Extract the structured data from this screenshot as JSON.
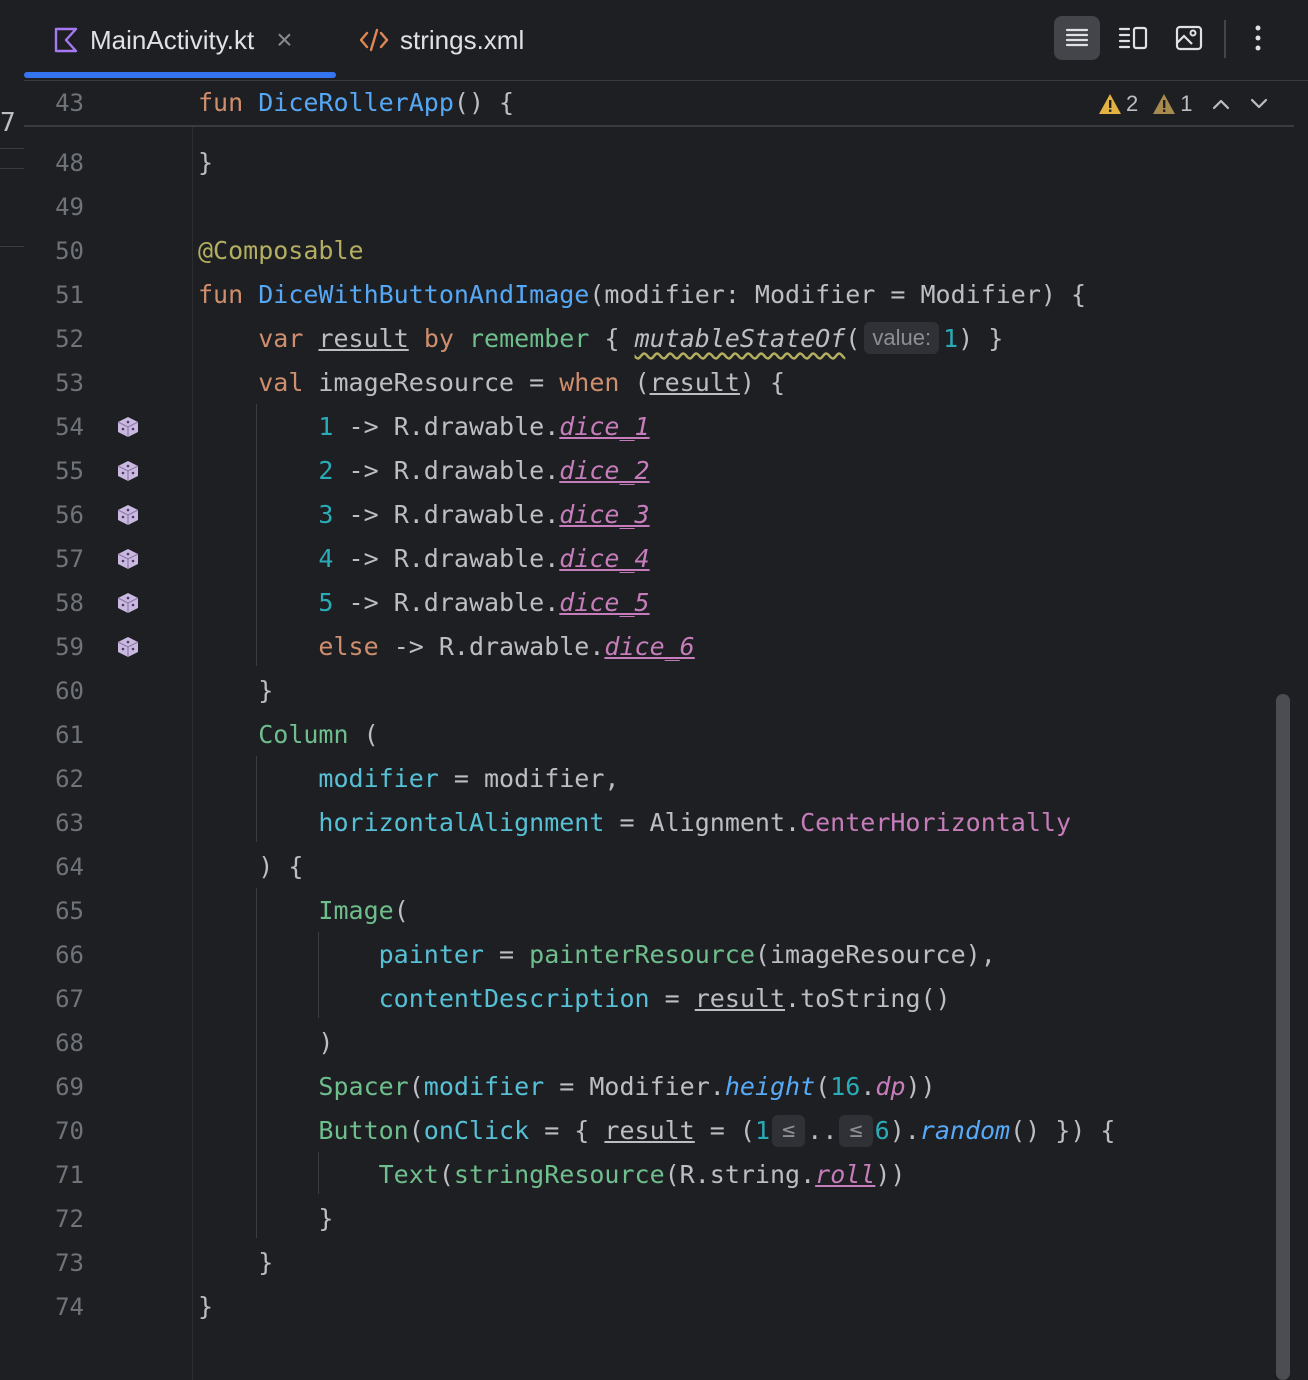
{
  "tabs": [
    {
      "label": "MainActivity.kt",
      "icon": "kotlin-file-icon",
      "active": true
    },
    {
      "label": "strings.xml",
      "icon": "xml-file-icon",
      "active": false
    }
  ],
  "inspection": {
    "warnings": "2",
    "weak_warnings": "1"
  },
  "left_strip_char": "7",
  "sticky": {
    "line": "43",
    "text": "fun DiceRollerApp() {"
  },
  "line_numbers": [
    "48",
    "49",
    "50",
    "51",
    "52",
    "53",
    "54",
    "55",
    "56",
    "57",
    "58",
    "59",
    "60",
    "61",
    "62",
    "63",
    "64",
    "65",
    "66",
    "67",
    "68",
    "69",
    "70",
    "71",
    "72",
    "73",
    "74"
  ],
  "code": {
    "l48": "}",
    "l50": "@Composable",
    "l51_kw": "fun",
    "l51_name": "DiceWithButtonAndImage",
    "l51_rest": "(modifier: Modifier = Modifier) {",
    "l52_var": "var",
    "l52_result": "result",
    "l52_by": "by",
    "l52_remember": "remember",
    "l52_brace": " { ",
    "l52_msof": "mutableStateOf",
    "l52_paren": "(",
    "l52_hint": "value:",
    "l52_one": "1",
    "l52_end": ") }",
    "l53_val": "val",
    "l53_mid": " imageResource = ",
    "l53_when": "when",
    "l53_open": " (",
    "l53_result": "result",
    "l53_end": ") {",
    "dice": [
      {
        "n": "1",
        "rest": " -> R.drawable.",
        "res": "dice_1"
      },
      {
        "n": "2",
        "rest": " -> R.drawable.",
        "res": "dice_2"
      },
      {
        "n": "3",
        "rest": " -> R.drawable.",
        "res": "dice_3"
      },
      {
        "n": "4",
        "rest": " -> R.drawable.",
        "res": "dice_4"
      },
      {
        "n": "5",
        "rest": " -> R.drawable.",
        "res": "dice_5"
      }
    ],
    "l59_else": "else",
    "l59_rest": " -> R.drawable.",
    "l59_res": "dice_6",
    "l60": "}",
    "l61_col": "Column",
    "l61_rest": " (",
    "l62_p": "modifier",
    "l62_rest": " = modifier,",
    "l63_p": "horizontalAlignment",
    "l63_rest": " = Alignment.",
    "l63_v": "CenterHorizontally",
    "l64": ") {",
    "l65_img": "Image",
    "l65_rest": "(",
    "l66_p": "painter",
    "l66_eq": " = ",
    "l66_fn": "painterResource",
    "l66_rest": "(imageResource),",
    "l67_p": "contentDescription",
    "l67_eq": " = ",
    "l67_result": "result",
    "l67_rest": ".toString()",
    "l68": ")",
    "l69_sp": "Spacer",
    "l69_open": "(",
    "l69_p": "modifier",
    "l69_mid": " = Modifier.",
    "l69_h": "height",
    "l69_open2": "(",
    "l69_num": "16",
    "l69_dot": ".",
    "l69_dp": "dp",
    "l69_end": "))",
    "l70_btn": "Button",
    "l70_open": "(",
    "l70_p": "onClick",
    "l70_mid": " = { ",
    "l70_result": "result",
    "l70_eq": " = (",
    "l70_one": "1",
    "l70_le1": "≤",
    "l70_dots": "..",
    "l70_le2": "≤",
    "l70_six": "6",
    "l70_close": ").",
    "l70_random": "random",
    "l70_end": "() }) {",
    "l71_text": "Text",
    "l71_open": "(",
    "l71_fn": "stringResource",
    "l71_mid": "(R.string.",
    "l71_roll": "roll",
    "l71_end": "))",
    "l72": "}",
    "l73": "}",
    "l74": "}"
  },
  "colors": {
    "background": "#1e1f22",
    "keyword": "#cf8e6d",
    "function": "#56a8f5",
    "annotation": "#b3ae60",
    "number": "#2aacb8",
    "parameter": "#56c1d6",
    "composable": "#6fbe8d",
    "property": "#c77dbb",
    "accent": "#3574f0"
  }
}
